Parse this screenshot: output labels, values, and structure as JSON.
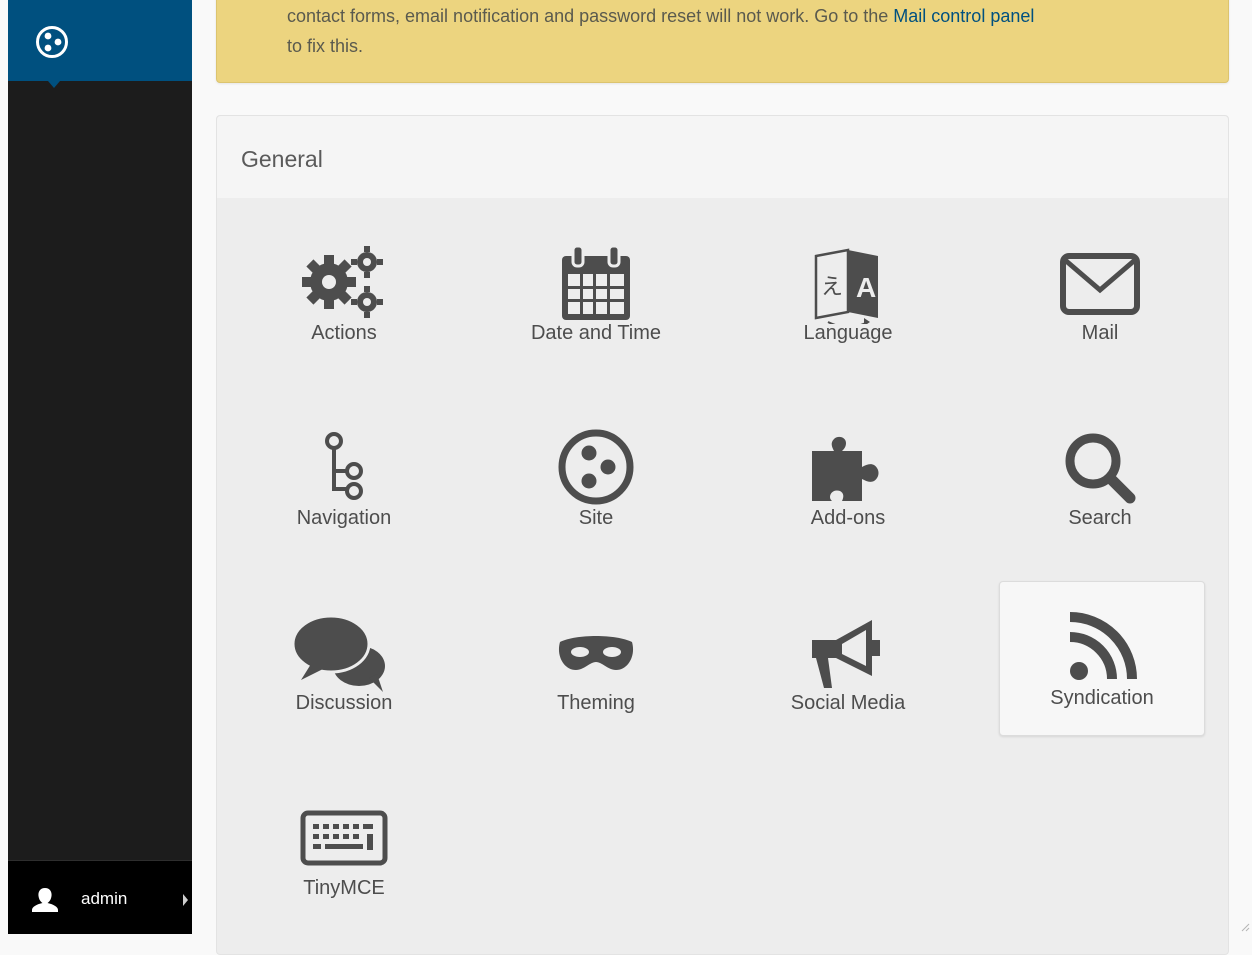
{
  "toolbar": {
    "user_name": "admin"
  },
  "warning": {
    "line1_text": "contact forms, email notification and password reset will not work. Go to the ",
    "link_text": "Mail control panel",
    "line2_text": "to fix this."
  },
  "panel": {
    "title": "General",
    "items": [
      {
        "label": "Actions",
        "icon": "gears-icon"
      },
      {
        "label": "Date and Time",
        "icon": "calendar-icon"
      },
      {
        "label": "Language",
        "icon": "language-icon"
      },
      {
        "label": "Mail",
        "icon": "mail-icon"
      },
      {
        "label": "Navigation",
        "icon": "navigation-icon"
      },
      {
        "label": "Site",
        "icon": "site-icon"
      },
      {
        "label": "Add-ons",
        "icon": "puzzle-icon"
      },
      {
        "label": "Search",
        "icon": "search-icon"
      },
      {
        "label": "Discussion",
        "icon": "chat-icon"
      },
      {
        "label": "Theming",
        "icon": "mask-icon"
      },
      {
        "label": "Social Media",
        "icon": "megaphone-icon"
      },
      {
        "label": "Syndication",
        "icon": "rss-icon"
      },
      {
        "label": "TinyMCE",
        "icon": "keyboard-icon"
      }
    ]
  },
  "colors": {
    "brand": "#00507f",
    "toolbar_bg": "#1c1c1c",
    "warning_bg": "#ecd47f",
    "icon_color": "#4d4d4d"
  }
}
